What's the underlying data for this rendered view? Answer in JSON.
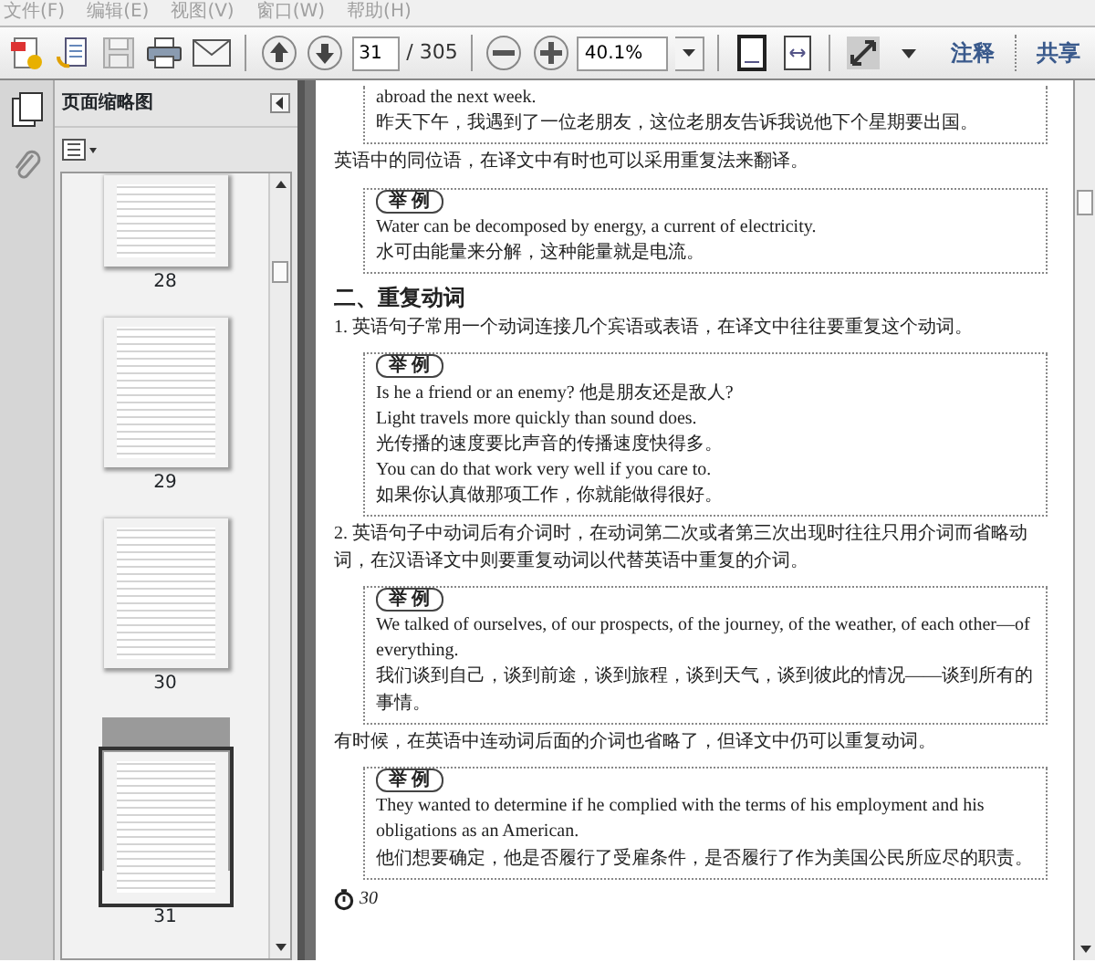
{
  "menu": [
    {
      "label": "文件(F)"
    },
    {
      "label": "编辑(E)"
    },
    {
      "label": "视图(V)"
    },
    {
      "label": "窗口(W)"
    },
    {
      "label": "帮助(H)"
    }
  ],
  "toolbar": {
    "page_number": "31",
    "page_total": "/ 305",
    "zoom": "40.1%",
    "buttons": [
      "注释",
      "共享"
    ]
  },
  "sidebar": {
    "title": "页面缩略图",
    "thumbnails": [
      {
        "label": "28",
        "selected": false
      },
      {
        "label": "29",
        "selected": false
      },
      {
        "label": "30",
        "selected": false
      },
      {
        "label": "31",
        "selected": true
      }
    ]
  },
  "document": {
    "blocks": [
      {
        "kind": "example",
        "lines": [
          "abroad the next week.",
          "昨天下午，我遇到了一位老朋友，这位老朋友告诉我说他下个星期要出国。"
        ]
      },
      {
        "kind": "paragraph",
        "text": "英语中的同位语，在译文中有时也可以采用重复法来翻译。"
      },
      {
        "kind": "example",
        "tag": "举 例",
        "lines": [
          "Water can be decomposed by energy, a current of electricity.",
          "水可由能量来分解，这种能量就是电流。"
        ]
      },
      {
        "kind": "heading",
        "text": "二、重复动词"
      },
      {
        "kind": "paragraph",
        "text": "1. 英语句子常用一个动词连接几个宾语或表语，在译文中往往要重复这个动词。"
      },
      {
        "kind": "example",
        "tag": "举 例",
        "lines": [
          "Is he a friend or an enemy? 他是朋友还是敌人?",
          "Light travels more quickly than sound does.",
          "光传播的速度要比声音的传播速度快得多。",
          "You can do that work very well if you care to.",
          "如果你认真做那项工作，你就能做得很好。"
        ]
      },
      {
        "kind": "paragraph",
        "text": "2. 英语句子中动词后有介词时，在动词第二次或者第三次出现时往往只用介词而省略动词，在汉语译文中则要重复动词以代替英语中重复的介词。"
      },
      {
        "kind": "example",
        "tag": "举 例",
        "lines": [
          "We talked of ourselves, of our prospects, of the journey, of the weather, of each other—of everything.",
          "我们谈到自己，谈到前途，谈到旅程，谈到天气，谈到彼此的情况——谈到所有的事情。"
        ]
      },
      {
        "kind": "paragraph",
        "text": "有时候，在英语中连动词后面的介词也省略了，但译文中仍可以重复动词。"
      },
      {
        "kind": "example",
        "tag": "举 例",
        "lines": [
          "They wanted to determine if he complied with the terms of his employment and his obligations as an American.",
          "他们想要确定，他是否履行了受雇条件，是否履行了作为美国公民所应尽的职责。"
        ]
      }
    ],
    "footer_page": "30"
  }
}
